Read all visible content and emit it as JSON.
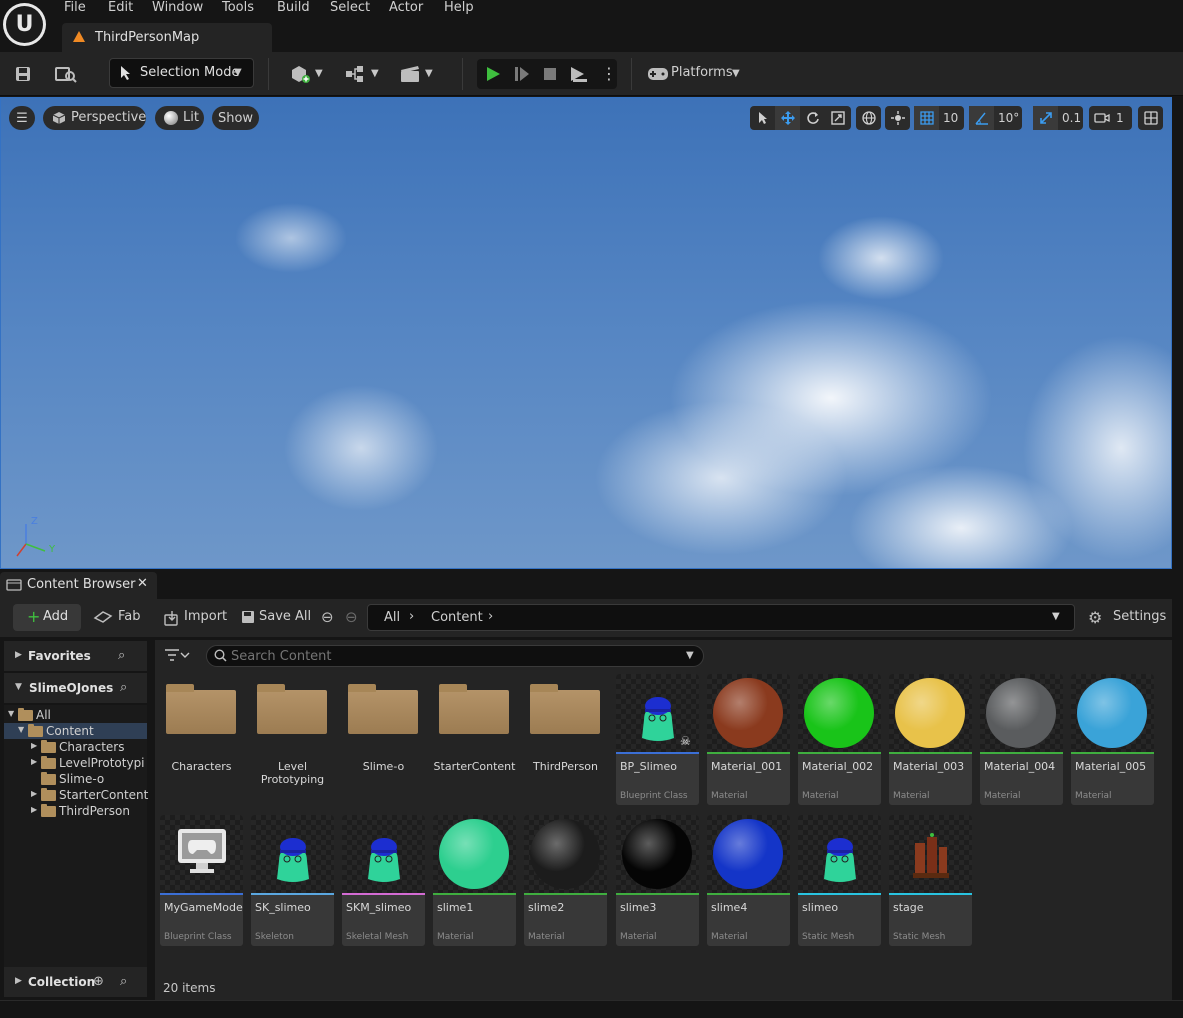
{
  "menu": {
    "items": [
      "File",
      "Edit",
      "Window",
      "Tools",
      "Build",
      "Select",
      "Actor",
      "Help"
    ]
  },
  "map_tab": {
    "title": "ThirdPersonMap"
  },
  "toolbar": {
    "selection_mode": "Selection Mode",
    "platforms": "Platforms"
  },
  "viewport": {
    "perspective": "Perspective",
    "lit": "Lit",
    "show": "Show",
    "grid_snap": "10",
    "rotation_snap": "10°",
    "scale_snap": "0.1",
    "camera_speed": "1",
    "axis_z": "Z",
    "axis_y": "Y"
  },
  "content_browser": {
    "tab_title": "Content Browser",
    "add_label": "Add",
    "fab_label": "Fab",
    "import_label": "Import",
    "save_all_label": "Save All",
    "breadcrumb": [
      "All",
      "Content"
    ],
    "settings_label": "Settings",
    "search_placeholder": "Search Content",
    "item_count": "20 items"
  },
  "left_panel": {
    "favorites": "Favorites",
    "project": "SlimeOJones",
    "collection": "Collection",
    "tree": [
      {
        "label": "All",
        "level": 0
      },
      {
        "label": "Content",
        "level": 1
      },
      {
        "label": "Characters",
        "level": 2
      },
      {
        "label": "LevelPrototypi",
        "level": 2
      },
      {
        "label": "Slime-o",
        "level": 2
      },
      {
        "label": "StarterContent",
        "level": 2
      },
      {
        "label": "ThirdPerson",
        "level": 2
      }
    ]
  },
  "assets": [
    {
      "name": "Characters",
      "kind": "folder"
    },
    {
      "name": "Level Prototyping",
      "kind": "folder"
    },
    {
      "name": "Slime-o",
      "kind": "folder"
    },
    {
      "name": "StarterContent",
      "kind": "folder"
    },
    {
      "name": "ThirdPerson",
      "kind": "folder"
    },
    {
      "name": "BP_Slimeo",
      "type": "Blueprint Class",
      "kind": "slime",
      "bar": "#3b6fd6"
    },
    {
      "name": "Material_001",
      "type": "Material",
      "kind": "sphere",
      "color": "#8a3a1e",
      "bar": "#3fae3f"
    },
    {
      "name": "Material_002",
      "type": "Material",
      "kind": "sphere",
      "color": "#19c419",
      "bar": "#3fae3f"
    },
    {
      "name": "Material_003",
      "type": "Material",
      "kind": "sphere",
      "color": "#e8c24a",
      "bar": "#3fae3f"
    },
    {
      "name": "Material_004",
      "type": "Material",
      "kind": "sphere",
      "color": "#5a5c5e",
      "bar": "#3fae3f"
    },
    {
      "name": "Material_005",
      "type": "Material",
      "kind": "sphere",
      "color": "#3aa3d8",
      "bar": "#3fae3f"
    },
    {
      "name": "MyGameMode",
      "type": "Blueprint Class",
      "kind": "gamemode",
      "bar": "#3b6fd6"
    },
    {
      "name": "SK_slimeo",
      "type": "Skeleton",
      "kind": "slime",
      "bar": "#5aa7e0"
    },
    {
      "name": "SKM_slimeo",
      "type": "Skeletal Mesh",
      "kind": "slime",
      "bar": "#d36bd3"
    },
    {
      "name": "slime1",
      "type": "Material",
      "kind": "sphere",
      "color": "#2dcf8f",
      "bar": "#3fae3f"
    },
    {
      "name": "slime2",
      "type": "Material",
      "kind": "sphere",
      "color": "#1c1c1c",
      "bar": "#3fae3f"
    },
    {
      "name": "slime3",
      "type": "Material",
      "kind": "sphere",
      "color": "#050505",
      "bar": "#3fae3f"
    },
    {
      "name": "slime4",
      "type": "Material",
      "kind": "sphere",
      "color": "#1435c8",
      "bar": "#3fae3f"
    },
    {
      "name": "slimeo",
      "type": "Static Mesh",
      "kind": "slime",
      "bar": "#29c3e0"
    },
    {
      "name": "stage",
      "type": "Static Mesh",
      "kind": "stage",
      "bar": "#29c3e0"
    }
  ]
}
